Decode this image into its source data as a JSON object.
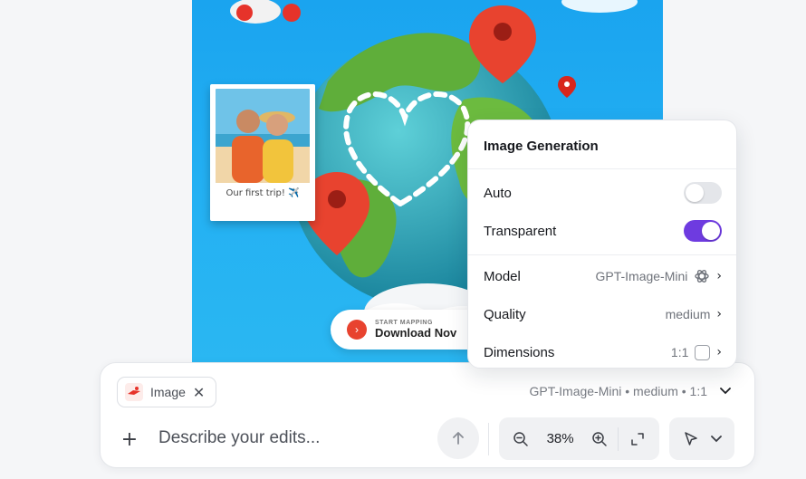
{
  "canvas": {
    "polaroid_caption": "Our first trip! ✈️",
    "cta_small": "START MAPPING",
    "cta_big": "Download Nov",
    "cta_icon": "chevron-right-icon"
  },
  "popover": {
    "title": "Image Generation",
    "auto": {
      "label": "Auto",
      "on": false
    },
    "transparent": {
      "label": "Transparent",
      "on": true
    },
    "model": {
      "label": "Model",
      "value": "GPT-Image-Mini",
      "icon": "openai-icon"
    },
    "quality": {
      "label": "Quality",
      "value": "medium"
    },
    "dimensions": {
      "label": "Dimensions",
      "value": "1:1",
      "icon": "square-aspect-icon"
    },
    "accent_color": "#6e3be0"
  },
  "composer": {
    "attachment_label": "Image",
    "summary": "GPT-Image-Mini • medium • 1:1",
    "prompt_placeholder": "Describe your edits...",
    "zoom_level": "38%"
  }
}
